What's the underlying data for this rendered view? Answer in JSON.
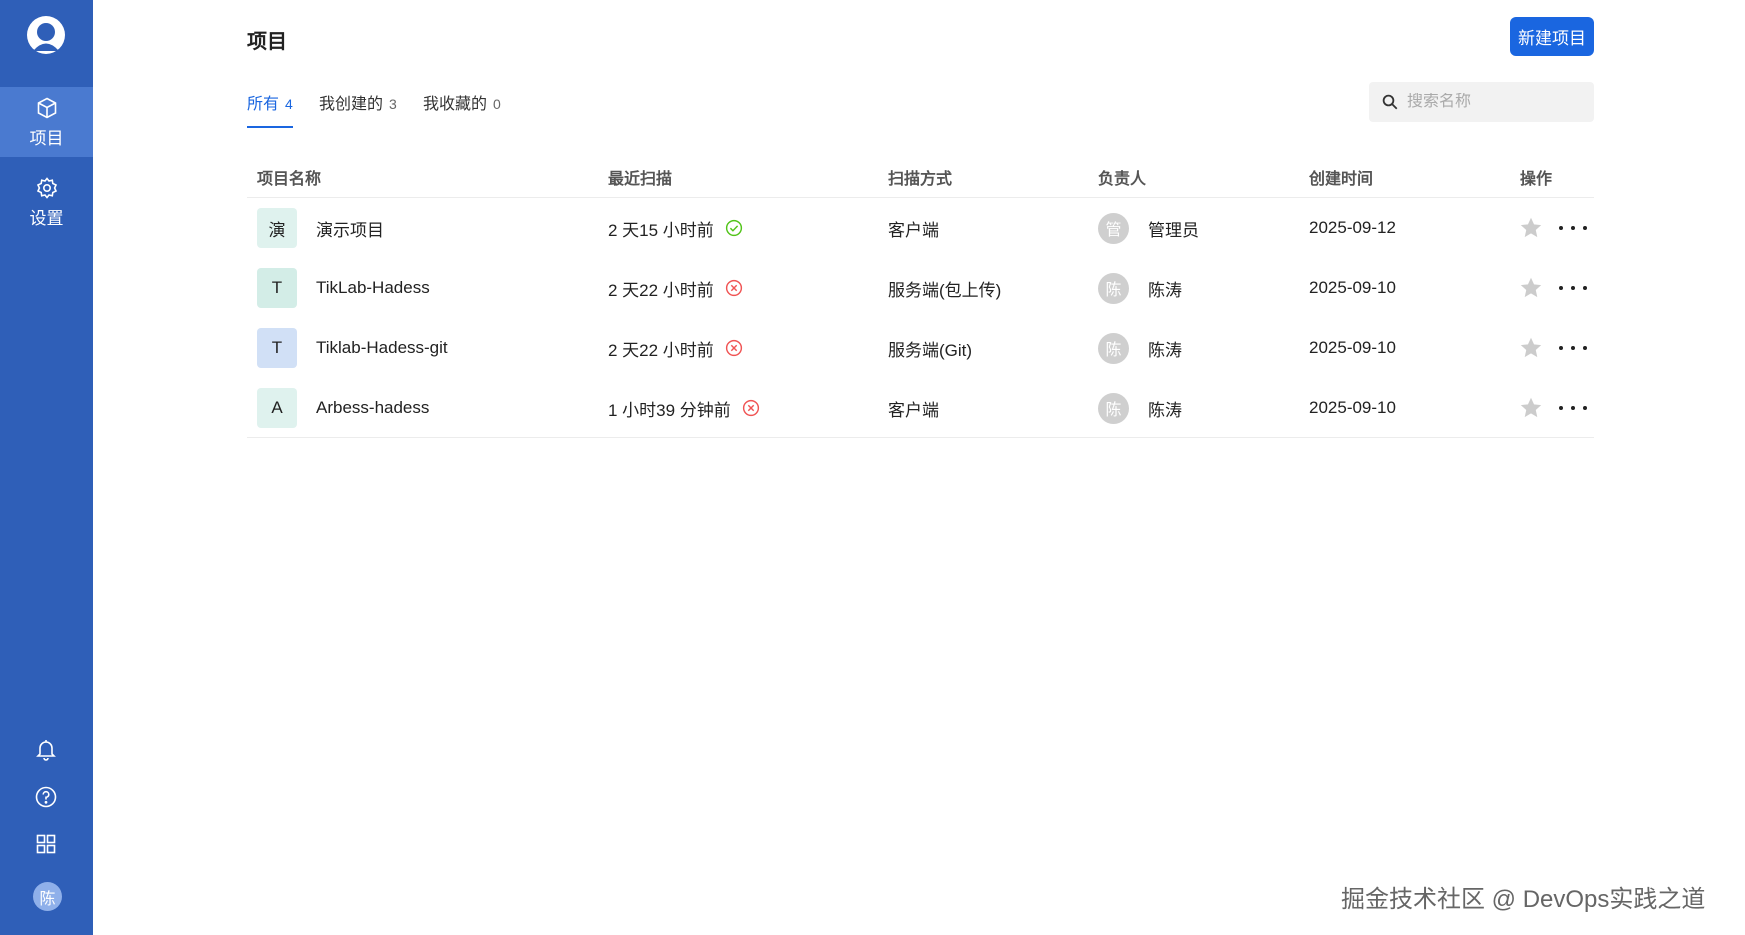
{
  "sidebar": {
    "nav": [
      {
        "label": "项目",
        "icon": "cube-icon",
        "active": true
      },
      {
        "label": "设置",
        "icon": "gear-icon",
        "active": false
      }
    ],
    "bottom_icons": [
      "bell-icon",
      "help-icon",
      "apps-grid-icon"
    ],
    "avatar_text": "陈"
  },
  "header": {
    "title": "项目",
    "new_button": "新建项目"
  },
  "tabs": [
    {
      "label": "所有",
      "count": "4",
      "active": true
    },
    {
      "label": "我创建的",
      "count": "3",
      "active": false
    },
    {
      "label": "我收藏的",
      "count": "0",
      "active": false
    }
  ],
  "search": {
    "placeholder": "搜索名称",
    "value": ""
  },
  "table": {
    "columns": [
      "项目名称",
      "最近扫描",
      "扫描方式",
      "负责人",
      "创建时间",
      "操作"
    ],
    "rows": [
      {
        "icon_letter": "演",
        "icon_bg": "#dff2ee",
        "name": "演示项目",
        "last_scan": "2 天15 小时前",
        "status": "success",
        "scan_mode": "客户端",
        "owner_avatar": "管",
        "owner": "管理员",
        "created": "2025-09-12"
      },
      {
        "icon_letter": "T",
        "icon_bg": "#d3ede7",
        "name": "TikLab-Hadess",
        "last_scan": "2 天22 小时前",
        "status": "error",
        "scan_mode": "服务端(包上传)",
        "owner_avatar": "陈",
        "owner": "陈涛",
        "created": "2025-09-10"
      },
      {
        "icon_letter": "T",
        "icon_bg": "#d1e0f6",
        "name": "Tiklab-Hadess-git",
        "last_scan": "2 天22 小时前",
        "status": "error",
        "scan_mode": "服务端(Git)",
        "owner_avatar": "陈",
        "owner": "陈涛",
        "created": "2025-09-10"
      },
      {
        "icon_letter": "A",
        "icon_bg": "#dff2ee",
        "name": "Arbess-hadess",
        "last_scan": "1 小时39 分钟前",
        "status": "error",
        "scan_mode": "客户端",
        "owner_avatar": "陈",
        "owner": "陈涛",
        "created": "2025-09-10"
      }
    ]
  },
  "colors": {
    "sidebar": "#2f5fb8",
    "sidebar_active": "#4a7ad0",
    "primary": "#1a66e0",
    "success": "#52c41a",
    "error": "#f05454",
    "star": "#cccccc"
  },
  "watermark": "掘金技术社区 @ DevOps实践之道"
}
